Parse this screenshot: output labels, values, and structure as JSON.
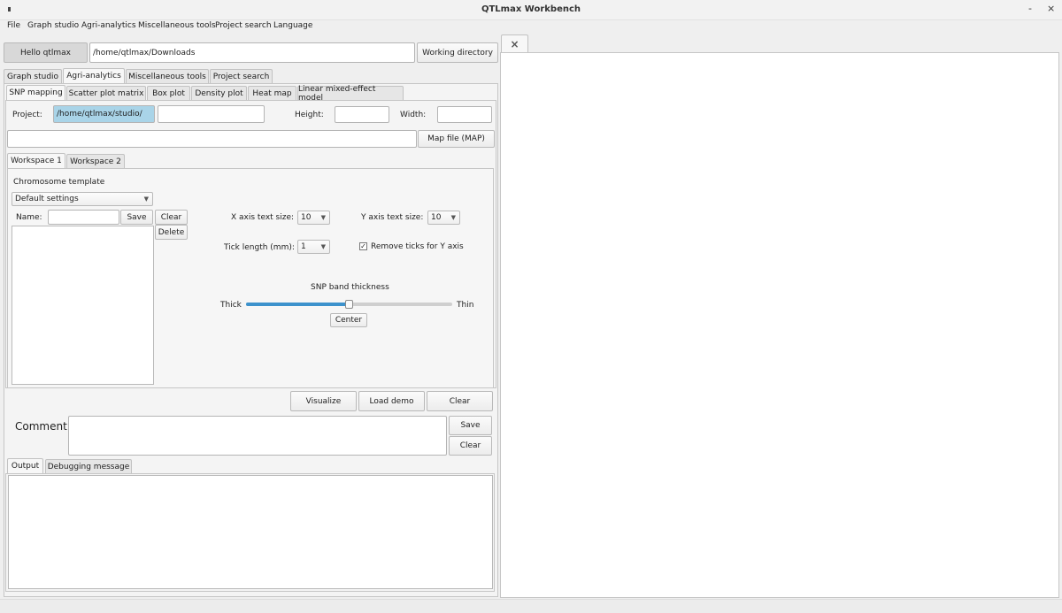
{
  "window": {
    "title": "QTLmax Workbench",
    "minimize": "-",
    "close": "×"
  },
  "menubar": [
    "File",
    "Graph studio",
    "Agri-analytics",
    "Miscellaneous tools",
    "Project search",
    "Language"
  ],
  "top": {
    "hello_button": "Hello qtlmax",
    "path_value": "/home/qtlmax/Downloads",
    "workdir_button": "Working directory"
  },
  "main_tabs": [
    "Graph studio",
    "Agri-analytics",
    "Miscellaneous tools",
    "Project search"
  ],
  "sub_tabs": [
    "SNP mapping",
    "Scatter plot matrix",
    "Box plot",
    "Density plot",
    "Heat map",
    "Linear mixed-effect model"
  ],
  "project": {
    "label": "Project:",
    "path_value": "/home/qtlmax/studio/",
    "name_value": "",
    "height_label": "Height:",
    "height_value": "",
    "width_label": "Width:",
    "width_value": "",
    "map_value": "",
    "map_button": "Map file (MAP)"
  },
  "workspace_tabs": [
    "Workspace 1",
    "Workspace 2"
  ],
  "template": {
    "heading": "Chromosome template",
    "select_value": "Default settings",
    "name_label": "Name:",
    "name_value": "",
    "save": "Save",
    "clear": "Clear",
    "delete": "Delete"
  },
  "settings": {
    "x_label": "X axis text size:",
    "x_value": "10",
    "y_label": "Y axis text size:",
    "y_value": "10",
    "tick_label": "Tick length (mm):",
    "tick_value": "1",
    "remove_ticks_label": "Remove ticks for Y axis",
    "remove_ticks_checked": true,
    "checkmark": "✓",
    "band_heading": "SNP band thickness",
    "thick": "Thick",
    "thin": "Thin",
    "slider_fraction": 0.5,
    "center_button": "Center"
  },
  "actions": {
    "visualize": "Visualize",
    "load_demo": "Load demo",
    "clear": "Clear"
  },
  "comment": {
    "label": "Comment:",
    "value": "",
    "save": "Save",
    "clear": "Clear"
  },
  "output_tabs": [
    "Output",
    "Debugging message"
  ],
  "right_panel": {
    "close_icon": "×"
  },
  "icons": {
    "dropdown": "chevron-down-icon",
    "close": "close-icon"
  },
  "colors": {
    "highlight": "#a9d4e8",
    "slider_fill": "#3d92cc"
  }
}
